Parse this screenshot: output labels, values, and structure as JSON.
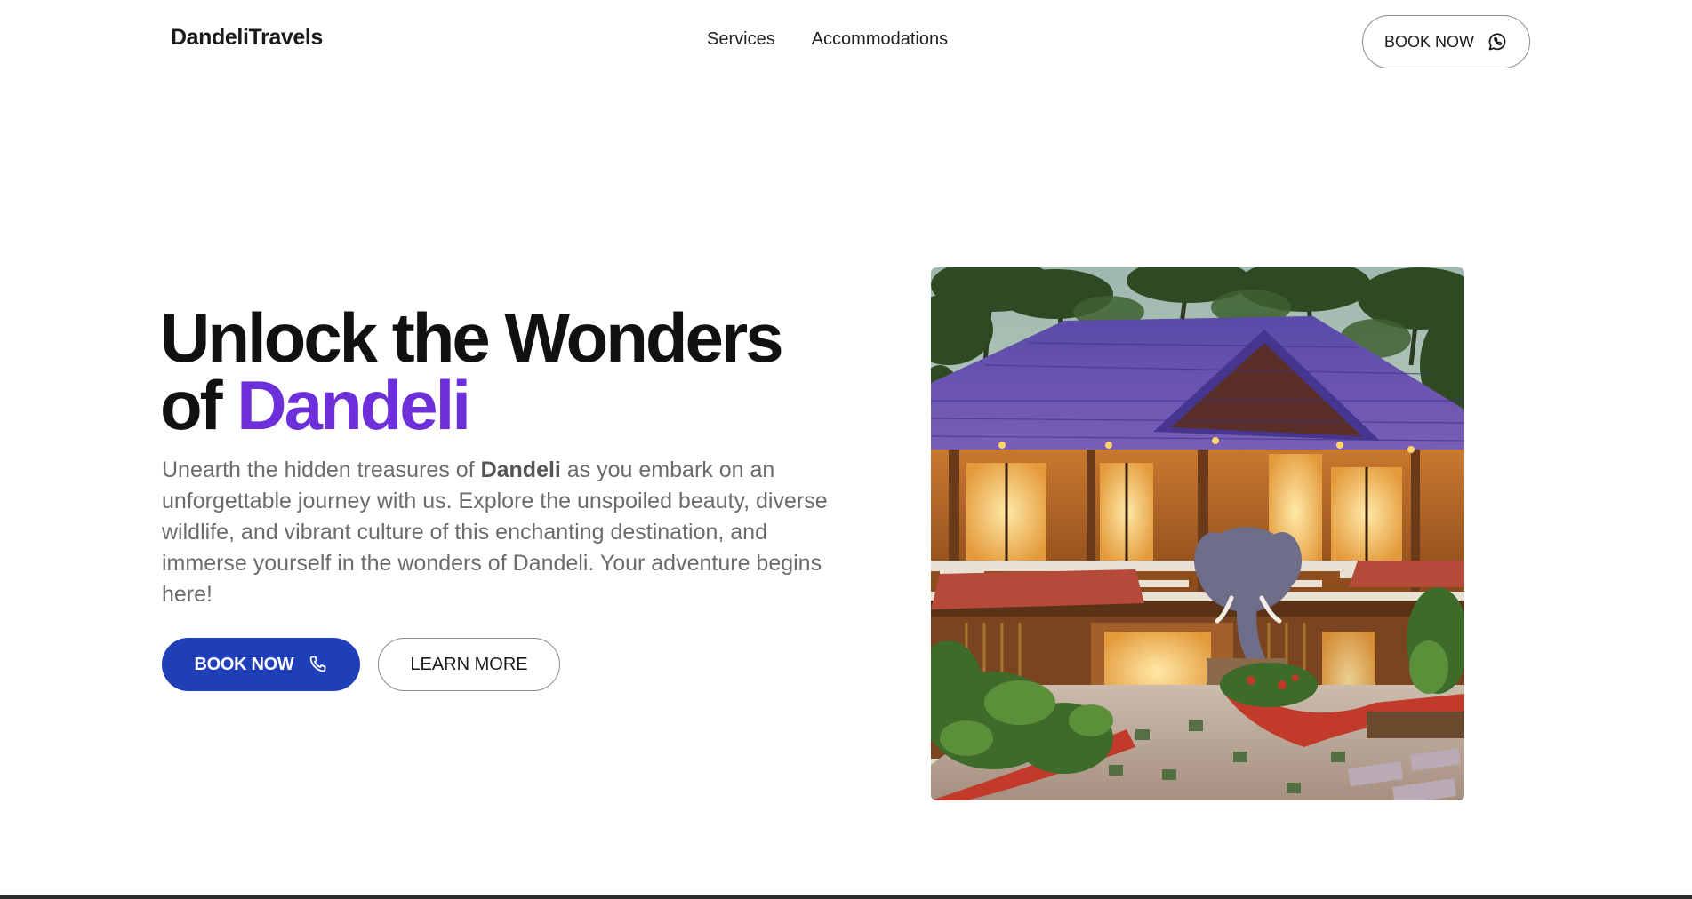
{
  "brand": {
    "name": "DandeliTravels"
  },
  "nav": {
    "items": [
      {
        "label": "Services"
      },
      {
        "label": "Accommodations"
      }
    ]
  },
  "header": {
    "book_label": "BOOK NOW",
    "book_icon": "whatsapp-icon"
  },
  "hero": {
    "title_line1": "Unlock the Wonders",
    "title_of": "of",
    "title_accent": "Dandeli",
    "desc_before": "Unearth the hidden treasures of ",
    "desc_bold": "Dandeli",
    "desc_after": " as you embark on an unforgettable journey with us. Explore the unspoiled beauty, diverse wildlife, and vibrant culture of this enchanting destination, and immerse yourself in the wonders of Dandeli. Your adventure begins here!",
    "book_label": "BOOK NOW",
    "book_icon": "phone-icon",
    "learn_label": "LEARN MORE"
  },
  "colors": {
    "accent_purple": "#6d2fd9",
    "primary_blue": "#1f3fb8",
    "text_dark": "#111111",
    "text_muted": "#6b6b6b"
  }
}
